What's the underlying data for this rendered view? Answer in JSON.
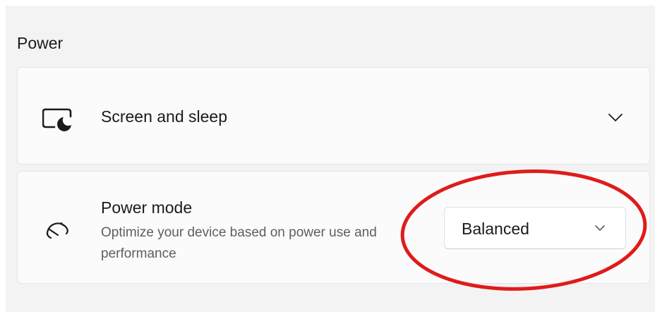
{
  "section": {
    "title": "Power"
  },
  "screen_and_sleep": {
    "label": "Screen and sleep",
    "icon": "screen-sleep-icon",
    "expand_icon": "chevron-down-icon"
  },
  "power_mode": {
    "label": "Power mode",
    "description": "Optimize your device based on power use and performance",
    "icon": "power-gauge-icon",
    "dropdown": {
      "selected": "Balanced",
      "icon": "chevron-down-icon"
    }
  },
  "annotation": {
    "shape": "ellipse",
    "color": "#e01b1b"
  },
  "colors": {
    "background": "#f3f3f3",
    "card": "#fbfbfb",
    "text_primary": "#1b1b1b",
    "text_secondary": "#5e5e5e"
  }
}
